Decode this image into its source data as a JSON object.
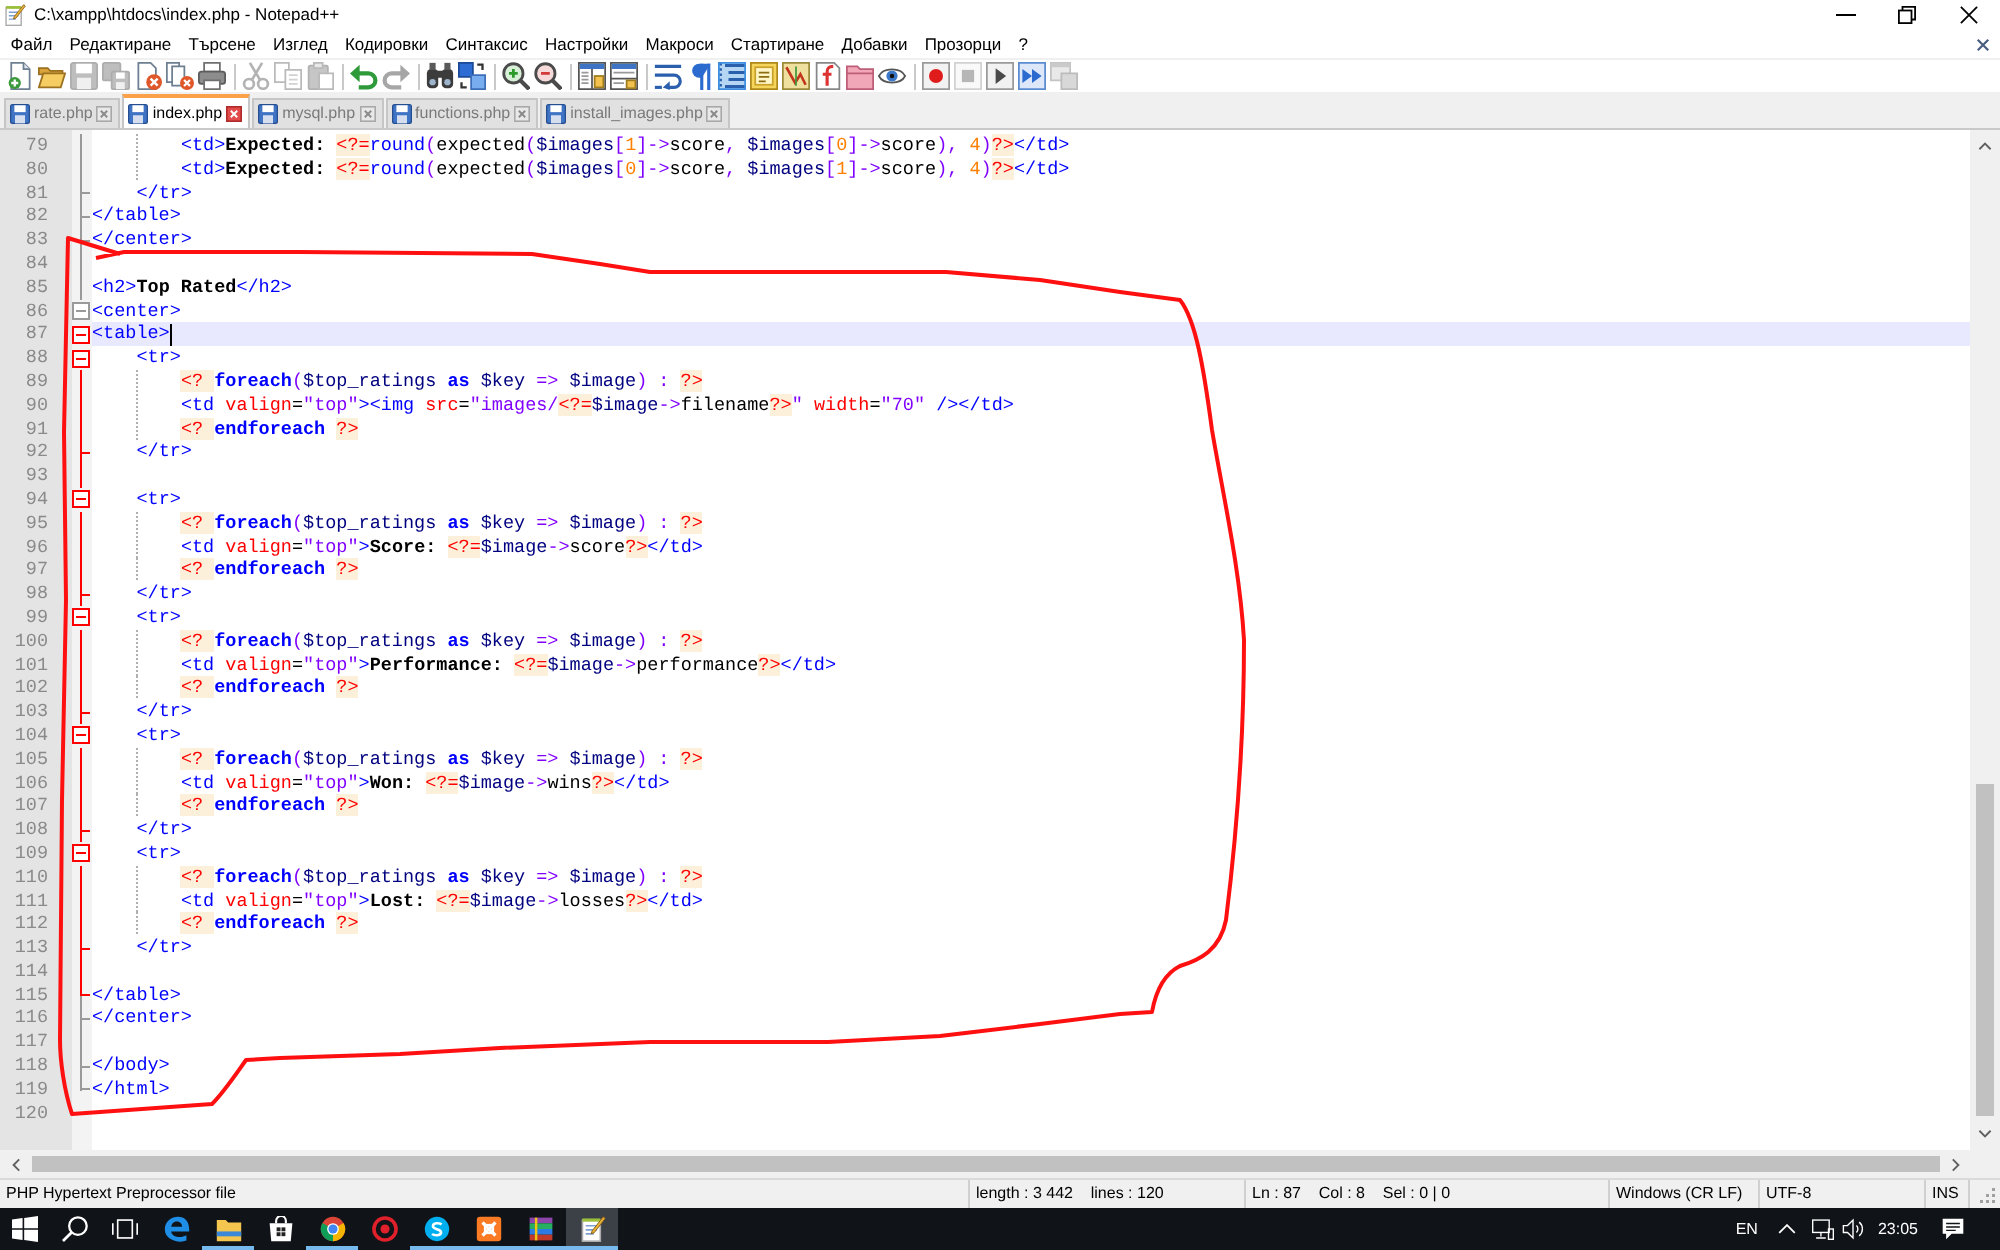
{
  "window": {
    "title": "C:\\xampp\\htdocs\\index.php - Notepad++"
  },
  "menu": [
    "Файл",
    "Редактиране",
    "Търсене",
    "Изглед",
    "Кодировки",
    "Синтаксис",
    "Настройки",
    "Макроси",
    "Стартиране",
    "Добавки",
    "Прозорци",
    "?"
  ],
  "toolbar": {
    "groups": [
      {
        "buttons": [
          {
            "kind": "new",
            "disabled": false,
            "on": false
          },
          {
            "kind": "open",
            "disabled": false,
            "on": false
          },
          {
            "kind": "save",
            "disabled": true,
            "on": false
          },
          {
            "kind": "save-all",
            "disabled": true,
            "on": false
          },
          {
            "kind": "close",
            "disabled": false,
            "on": false
          },
          {
            "kind": "close-all",
            "disabled": false,
            "on": false
          },
          {
            "kind": "print",
            "disabled": false,
            "on": false
          }
        ]
      },
      {
        "buttons": [
          {
            "kind": "cut",
            "disabled": true,
            "on": false
          },
          {
            "kind": "copy",
            "disabled": true,
            "on": false
          },
          {
            "kind": "paste",
            "disabled": true,
            "on": false
          }
        ]
      },
      {
        "buttons": [
          {
            "kind": "undo",
            "disabled": false,
            "on": false
          },
          {
            "kind": "redo",
            "disabled": true,
            "on": false
          }
        ]
      },
      {
        "buttons": [
          {
            "kind": "find",
            "disabled": false,
            "on": false
          },
          {
            "kind": "replace",
            "disabled": false,
            "on": false
          }
        ]
      },
      {
        "buttons": [
          {
            "kind": "zoom-in",
            "disabled": false,
            "on": false
          },
          {
            "kind": "zoom-out",
            "disabled": false,
            "on": false
          }
        ]
      },
      {
        "buttons": [
          {
            "kind": "sync-vertical",
            "disabled": false,
            "on": false
          },
          {
            "kind": "sync-horizontal",
            "disabled": false,
            "on": false
          }
        ]
      },
      {
        "buttons": [
          {
            "kind": "word-wrap",
            "disabled": false,
            "on": false
          },
          {
            "kind": "show-all",
            "disabled": false,
            "on": false
          },
          {
            "kind": "indent-guide",
            "disabled": false,
            "on": true
          },
          {
            "kind": "user-language",
            "disabled": false,
            "on": false
          },
          {
            "kind": "document-map",
            "disabled": false,
            "on": false
          },
          {
            "kind": "function-list",
            "disabled": false,
            "on": false
          },
          {
            "kind": "folder-workspace",
            "disabled": false,
            "on": false
          },
          {
            "kind": "monitoring",
            "disabled": false,
            "on": false
          }
        ]
      },
      {
        "buttons": [
          {
            "kind": "record",
            "disabled": false,
            "on": false
          },
          {
            "kind": "stop",
            "disabled": true,
            "on": false
          },
          {
            "kind": "play",
            "disabled": false,
            "on": false
          },
          {
            "kind": "play-multiple",
            "disabled": false,
            "on": false
          },
          {
            "kind": "save-macro",
            "disabled": true,
            "on": false
          }
        ]
      }
    ]
  },
  "tabs": [
    {
      "label": "rate.php",
      "selected": false
    },
    {
      "label": "index.php",
      "selected": true
    },
    {
      "label": "mysql.php",
      "selected": false
    },
    {
      "label": "functions.php",
      "selected": false
    },
    {
      "label": "install_images.php",
      "selected": false
    }
  ],
  "editor": {
    "lines": [
      {
        "number": "79",
        "tokens": [
          {
            "kind": "tag",
            "text": "        <td>"
          },
          {
            "kind": "text",
            "text": "Expected: "
          },
          {
            "kind": "php-delim",
            "text": "<?="
          },
          {
            "kind": "php-func",
            "text": "round"
          },
          {
            "kind": "php-op",
            "text": "("
          },
          {
            "kind": "plain",
            "text": "expected"
          },
          {
            "kind": "php-op",
            "text": "("
          },
          {
            "kind": "php-var",
            "text": "$images"
          },
          {
            "kind": "php-op",
            "text": "["
          },
          {
            "kind": "php-num",
            "text": "1"
          },
          {
            "kind": "php-op",
            "text": "]->"
          },
          {
            "kind": "plain",
            "text": "score"
          },
          {
            "kind": "php-op",
            "text": ", "
          },
          {
            "kind": "php-var",
            "text": "$images"
          },
          {
            "kind": "php-op",
            "text": "["
          },
          {
            "kind": "php-num",
            "text": "0"
          },
          {
            "kind": "php-op",
            "text": "]->"
          },
          {
            "kind": "plain",
            "text": "score"
          },
          {
            "kind": "php-op",
            "text": "), "
          },
          {
            "kind": "php-num",
            "text": "4"
          },
          {
            "kind": "php-op",
            "text": ")"
          },
          {
            "kind": "php-delim",
            "text": "?>"
          },
          {
            "kind": "tag",
            "text": "</td>"
          }
        ],
        "fold": {
          "kind": "line",
          "highlight": false
        },
        "current": false
      },
      {
        "number": "80",
        "tokens": [
          {
            "kind": "tag",
            "text": "        <td>"
          },
          {
            "kind": "text",
            "text": "Expected: "
          },
          {
            "kind": "php-delim",
            "text": "<?="
          },
          {
            "kind": "php-func",
            "text": "round"
          },
          {
            "kind": "php-op",
            "text": "("
          },
          {
            "kind": "plain",
            "text": "expected"
          },
          {
            "kind": "php-op",
            "text": "("
          },
          {
            "kind": "php-var",
            "text": "$images"
          },
          {
            "kind": "php-op",
            "text": "["
          },
          {
            "kind": "php-num",
            "text": "0"
          },
          {
            "kind": "php-op",
            "text": "]->"
          },
          {
            "kind": "plain",
            "text": "score"
          },
          {
            "kind": "php-op",
            "text": ", "
          },
          {
            "kind": "php-var",
            "text": "$images"
          },
          {
            "kind": "php-op",
            "text": "["
          },
          {
            "kind": "php-num",
            "text": "1"
          },
          {
            "kind": "php-op",
            "text": "]->"
          },
          {
            "kind": "plain",
            "text": "score"
          },
          {
            "kind": "php-op",
            "text": "), "
          },
          {
            "kind": "php-num",
            "text": "4"
          },
          {
            "kind": "php-op",
            "text": ")"
          },
          {
            "kind": "php-delim",
            "text": "?>"
          },
          {
            "kind": "tag",
            "text": "</td>"
          }
        ],
        "fold": {
          "kind": "line",
          "highlight": false
        },
        "current": false
      },
      {
        "number": "81",
        "tokens": [
          {
            "kind": "tag",
            "text": "    </tr>"
          }
        ],
        "fold": {
          "kind": "tick",
          "highlight": false
        },
        "current": false
      },
      {
        "number": "82",
        "tokens": [
          {
            "kind": "tag",
            "text": "</table>"
          }
        ],
        "fold": {
          "kind": "tick",
          "highlight": false
        },
        "current": false
      },
      {
        "number": "83",
        "tokens": [
          {
            "kind": "tag",
            "text": "</center>"
          }
        ],
        "fold": {
          "kind": "tick",
          "highlight": false
        },
        "current": false
      },
      {
        "number": "84",
        "fold": {
          "kind": "line",
          "highlight": false
        },
        "current": false
      },
      {
        "number": "85",
        "tokens": [
          {
            "kind": "tag",
            "text": "<h2>"
          },
          {
            "kind": "text",
            "text": "Top Rated"
          },
          {
            "kind": "tag",
            "text": "</h2>"
          }
        ],
        "fold": {
          "kind": "line",
          "highlight": false
        },
        "current": false
      },
      {
        "number": "86",
        "tokens": [
          {
            "kind": "tag",
            "text": "<center>"
          }
        ],
        "fold": {
          "kind": "box",
          "highlight": false
        },
        "current": false
      },
      {
        "number": "87",
        "tokens": [
          {
            "kind": "tag",
            "text": "<table>"
          }
        ],
        "fold": {
          "kind": "box",
          "highlight": true
        },
        "current": true
      },
      {
        "number": "88",
        "tokens": [
          {
            "kind": "tag",
            "text": "    <tr>"
          }
        ],
        "fold": {
          "kind": "box",
          "highlight": true
        },
        "current": false
      },
      {
        "number": "89",
        "tokens": [
          {
            "kind": "php-delim",
            "text": "        <? "
          },
          {
            "kind": "php-keyword",
            "text": "foreach"
          },
          {
            "kind": "php-op",
            "text": "("
          },
          {
            "kind": "php-var",
            "text": "$top_ratings "
          },
          {
            "kind": "php-keyword",
            "text": "as "
          },
          {
            "kind": "php-var",
            "text": "$key "
          },
          {
            "kind": "php-op",
            "text": "=> "
          },
          {
            "kind": "php-var",
            "text": "$image"
          },
          {
            "kind": "php-op",
            "text": ") : "
          },
          {
            "kind": "php-delim",
            "text": "?>"
          }
        ],
        "fold": {
          "kind": "line",
          "highlight": true
        },
        "current": false
      },
      {
        "number": "90",
        "tokens": [
          {
            "kind": "tag",
            "text": "        <td "
          },
          {
            "kind": "attr",
            "text": "valign"
          },
          {
            "kind": "plain",
            "text": "="
          },
          {
            "kind": "value",
            "text": "\"top\""
          },
          {
            "kind": "tag",
            "text": "><img "
          },
          {
            "kind": "attr",
            "text": "src"
          },
          {
            "kind": "plain",
            "text": "="
          },
          {
            "kind": "value",
            "text": "\"images/"
          },
          {
            "kind": "php-delim",
            "text": "<?="
          },
          {
            "kind": "php-var",
            "text": "$image"
          },
          {
            "kind": "php-op",
            "text": "->"
          },
          {
            "kind": "plain",
            "text": "filename"
          },
          {
            "kind": "php-delim",
            "text": "?>"
          },
          {
            "kind": "value",
            "text": "\" "
          },
          {
            "kind": "attr",
            "text": "width"
          },
          {
            "kind": "plain",
            "text": "="
          },
          {
            "kind": "value",
            "text": "\"70\""
          },
          {
            "kind": "tag",
            "text": " /></td>"
          }
        ],
        "fold": {
          "kind": "line",
          "highlight": true
        },
        "current": false
      },
      {
        "number": "91",
        "tokens": [
          {
            "kind": "php-delim",
            "text": "        <? "
          },
          {
            "kind": "php-keyword",
            "text": "endforeach "
          },
          {
            "kind": "php-delim",
            "text": "?>"
          }
        ],
        "fold": {
          "kind": "line",
          "highlight": true
        },
        "current": false
      },
      {
        "number": "92",
        "tokens": [
          {
            "kind": "tag",
            "text": "    </tr>"
          }
        ],
        "fold": {
          "kind": "tick",
          "highlight": true
        },
        "current": false
      },
      {
        "number": "93",
        "fold": {
          "kind": "line",
          "highlight": true
        },
        "current": false
      },
      {
        "number": "94",
        "tokens": [
          {
            "kind": "tag",
            "text": "    <tr>"
          }
        ],
        "fold": {
          "kind": "box",
          "highlight": true
        },
        "current": false
      },
      {
        "number": "95",
        "tokens": [
          {
            "kind": "php-delim",
            "text": "        <? "
          },
          {
            "kind": "php-keyword",
            "text": "foreach"
          },
          {
            "kind": "php-op",
            "text": "("
          },
          {
            "kind": "php-var",
            "text": "$top_ratings "
          },
          {
            "kind": "php-keyword",
            "text": "as "
          },
          {
            "kind": "php-var",
            "text": "$key "
          },
          {
            "kind": "php-op",
            "text": "=> "
          },
          {
            "kind": "php-var",
            "text": "$image"
          },
          {
            "kind": "php-op",
            "text": ") : "
          },
          {
            "kind": "php-delim",
            "text": "?>"
          }
        ],
        "fold": {
          "kind": "line",
          "highlight": true
        },
        "current": false
      },
      {
        "number": "96",
        "tokens": [
          {
            "kind": "tag",
            "text": "        <td "
          },
          {
            "kind": "attr",
            "text": "valign"
          },
          {
            "kind": "plain",
            "text": "="
          },
          {
            "kind": "value",
            "text": "\"top\""
          },
          {
            "kind": "tag",
            "text": ">"
          },
          {
            "kind": "text",
            "text": "Score: "
          },
          {
            "kind": "php-delim",
            "text": "<?="
          },
          {
            "kind": "php-var",
            "text": "$image"
          },
          {
            "kind": "php-op",
            "text": "->"
          },
          {
            "kind": "plain",
            "text": "score"
          },
          {
            "kind": "php-delim",
            "text": "?>"
          },
          {
            "kind": "tag",
            "text": "</td>"
          }
        ],
        "fold": {
          "kind": "line",
          "highlight": true
        },
        "current": false
      },
      {
        "number": "97",
        "tokens": [
          {
            "kind": "php-delim",
            "text": "        <? "
          },
          {
            "kind": "php-keyword",
            "text": "endforeach "
          },
          {
            "kind": "php-delim",
            "text": "?>"
          }
        ],
        "fold": {
          "kind": "line",
          "highlight": true
        },
        "current": false
      },
      {
        "number": "98",
        "tokens": [
          {
            "kind": "tag",
            "text": "    </tr>"
          }
        ],
        "fold": {
          "kind": "tick",
          "highlight": true
        },
        "current": false
      },
      {
        "number": "99",
        "tokens": [
          {
            "kind": "tag",
            "text": "    <tr>"
          }
        ],
        "fold": {
          "kind": "box",
          "highlight": true
        },
        "current": false
      },
      {
        "number": "100",
        "tokens": [
          {
            "kind": "php-delim",
            "text": "        <? "
          },
          {
            "kind": "php-keyword",
            "text": "foreach"
          },
          {
            "kind": "php-op",
            "text": "("
          },
          {
            "kind": "php-var",
            "text": "$top_ratings "
          },
          {
            "kind": "php-keyword",
            "text": "as "
          },
          {
            "kind": "php-var",
            "text": "$key "
          },
          {
            "kind": "php-op",
            "text": "=> "
          },
          {
            "kind": "php-var",
            "text": "$image"
          },
          {
            "kind": "php-op",
            "text": ") : "
          },
          {
            "kind": "php-delim",
            "text": "?>"
          }
        ],
        "fold": {
          "kind": "line",
          "highlight": true
        },
        "current": false
      },
      {
        "number": "101",
        "tokens": [
          {
            "kind": "tag",
            "text": "        <td "
          },
          {
            "kind": "attr",
            "text": "valign"
          },
          {
            "kind": "plain",
            "text": "="
          },
          {
            "kind": "value",
            "text": "\"top\""
          },
          {
            "kind": "tag",
            "text": ">"
          },
          {
            "kind": "text",
            "text": "Performance: "
          },
          {
            "kind": "php-delim",
            "text": "<?="
          },
          {
            "kind": "php-var",
            "text": "$image"
          },
          {
            "kind": "php-op",
            "text": "->"
          },
          {
            "kind": "plain",
            "text": "performance"
          },
          {
            "kind": "php-delim",
            "text": "?>"
          },
          {
            "kind": "tag",
            "text": "</td>"
          }
        ],
        "fold": {
          "kind": "line",
          "highlight": true
        },
        "current": false
      },
      {
        "number": "102",
        "tokens": [
          {
            "kind": "php-delim",
            "text": "        <? "
          },
          {
            "kind": "php-keyword",
            "text": "endforeach "
          },
          {
            "kind": "php-delim",
            "text": "?>"
          }
        ],
        "fold": {
          "kind": "line",
          "highlight": true
        },
        "current": false
      },
      {
        "number": "103",
        "tokens": [
          {
            "kind": "tag",
            "text": "    </tr>"
          }
        ],
        "fold": {
          "kind": "tick",
          "highlight": true
        },
        "current": false
      },
      {
        "number": "104",
        "tokens": [
          {
            "kind": "tag",
            "text": "    <tr>"
          }
        ],
        "fold": {
          "kind": "box",
          "highlight": true
        },
        "current": false
      },
      {
        "number": "105",
        "tokens": [
          {
            "kind": "php-delim",
            "text": "        <? "
          },
          {
            "kind": "php-keyword",
            "text": "foreach"
          },
          {
            "kind": "php-op",
            "text": "("
          },
          {
            "kind": "php-var",
            "text": "$top_ratings "
          },
          {
            "kind": "php-keyword",
            "text": "as "
          },
          {
            "kind": "php-var",
            "text": "$key "
          },
          {
            "kind": "php-op",
            "text": "=> "
          },
          {
            "kind": "php-var",
            "text": "$image"
          },
          {
            "kind": "php-op",
            "text": ") : "
          },
          {
            "kind": "php-delim",
            "text": "?>"
          }
        ],
        "fold": {
          "kind": "line",
          "highlight": true
        },
        "current": false
      },
      {
        "number": "106",
        "tokens": [
          {
            "kind": "tag",
            "text": "        <td "
          },
          {
            "kind": "attr",
            "text": "valign"
          },
          {
            "kind": "plain",
            "text": "="
          },
          {
            "kind": "value",
            "text": "\"top\""
          },
          {
            "kind": "tag",
            "text": ">"
          },
          {
            "kind": "text",
            "text": "Won: "
          },
          {
            "kind": "php-delim",
            "text": "<?="
          },
          {
            "kind": "php-var",
            "text": "$image"
          },
          {
            "kind": "php-op",
            "text": "->"
          },
          {
            "kind": "plain",
            "text": "wins"
          },
          {
            "kind": "php-delim",
            "text": "?>"
          },
          {
            "kind": "tag",
            "text": "</td>"
          }
        ],
        "fold": {
          "kind": "line",
          "highlight": true
        },
        "current": false
      },
      {
        "number": "107",
        "tokens": [
          {
            "kind": "php-delim",
            "text": "        <? "
          },
          {
            "kind": "php-keyword",
            "text": "endforeach "
          },
          {
            "kind": "php-delim",
            "text": "?>"
          }
        ],
        "fold": {
          "kind": "line",
          "highlight": true
        },
        "current": false
      },
      {
        "number": "108",
        "tokens": [
          {
            "kind": "tag",
            "text": "    </tr>"
          }
        ],
        "fold": {
          "kind": "tick",
          "highlight": true
        },
        "current": false
      },
      {
        "number": "109",
        "tokens": [
          {
            "kind": "tag",
            "text": "    <tr>"
          }
        ],
        "fold": {
          "kind": "box",
          "highlight": true
        },
        "current": false
      },
      {
        "number": "110",
        "tokens": [
          {
            "kind": "php-delim",
            "text": "        <? "
          },
          {
            "kind": "php-keyword",
            "text": "foreach"
          },
          {
            "kind": "php-op",
            "text": "("
          },
          {
            "kind": "php-var",
            "text": "$top_ratings "
          },
          {
            "kind": "php-keyword",
            "text": "as "
          },
          {
            "kind": "php-var",
            "text": "$key "
          },
          {
            "kind": "php-op",
            "text": "=> "
          },
          {
            "kind": "php-var",
            "text": "$image"
          },
          {
            "kind": "php-op",
            "text": ") : "
          },
          {
            "kind": "php-delim",
            "text": "?>"
          }
        ],
        "fold": {
          "kind": "line",
          "highlight": true
        },
        "current": false
      },
      {
        "number": "111",
        "tokens": [
          {
            "kind": "tag",
            "text": "        <td "
          },
          {
            "kind": "attr",
            "text": "valign"
          },
          {
            "kind": "plain",
            "text": "="
          },
          {
            "kind": "value",
            "text": "\"top\""
          },
          {
            "kind": "tag",
            "text": ">"
          },
          {
            "kind": "text",
            "text": "Lost: "
          },
          {
            "kind": "php-delim",
            "text": "<?="
          },
          {
            "kind": "php-var",
            "text": "$image"
          },
          {
            "kind": "php-op",
            "text": "->"
          },
          {
            "kind": "plain",
            "text": "losses"
          },
          {
            "kind": "php-delim",
            "text": "?>"
          },
          {
            "kind": "tag",
            "text": "</td>"
          }
        ],
        "fold": {
          "kind": "line",
          "highlight": true
        },
        "current": false
      },
      {
        "number": "112",
        "tokens": [
          {
            "kind": "php-delim",
            "text": "        <? "
          },
          {
            "kind": "php-keyword",
            "text": "endforeach "
          },
          {
            "kind": "php-delim",
            "text": "?>"
          }
        ],
        "fold": {
          "kind": "line",
          "highlight": true
        },
        "current": false
      },
      {
        "number": "113",
        "tokens": [
          {
            "kind": "tag",
            "text": "    </tr>"
          }
        ],
        "fold": {
          "kind": "tick",
          "highlight": true
        },
        "current": false
      },
      {
        "number": "114",
        "fold": {
          "kind": "line",
          "highlight": true
        },
        "current": false
      },
      {
        "number": "115",
        "tokens": [
          {
            "kind": "tag",
            "text": "</table>"
          }
        ],
        "fold": {
          "kind": "tick",
          "highlight": true
        },
        "current": false
      },
      {
        "number": "116",
        "tokens": [
          {
            "kind": "tag",
            "text": "</center>"
          }
        ],
        "fold": {
          "kind": "tick",
          "highlight": false
        },
        "current": false
      },
      {
        "number": "117",
        "fold": {
          "kind": "line",
          "highlight": false
        },
        "current": false
      },
      {
        "number": "118",
        "tokens": [
          {
            "kind": "tag",
            "text": "</body>"
          }
        ],
        "fold": {
          "kind": "tick",
          "highlight": false
        },
        "current": false
      },
      {
        "number": "119",
        "tokens": [
          {
            "kind": "tag",
            "text": "</html>"
          }
        ],
        "fold": {
          "kind": "end",
          "highlight": false
        },
        "current": false
      },
      {
        "number": "120",
        "current": false
      }
    ]
  },
  "annotation": {
    "kind": "freehand-outline"
  },
  "status_bar": [
    "PHP Hypertext Preprocessor file",
    "length : 3 442    lines : 120",
    "Ln : 87    Col : 8    Sel : 0 | 0",
    "Windows (CR LF)",
    "UTF-8",
    "INS"
  ],
  "taskbar": {
    "system_buttons": [
      {
        "kind": "start"
      },
      {
        "kind": "search"
      },
      {
        "kind": "task-view"
      }
    ],
    "apps": [
      {
        "kind": "e-logo",
        "running": false,
        "selected": false
      },
      {
        "kind": "folder",
        "running": true,
        "selected": false
      },
      {
        "kind": "bag",
        "running": false,
        "selected": false
      },
      {
        "kind": "ring-logo",
        "running": true,
        "selected": false
      },
      {
        "kind": "target",
        "running": false,
        "selected": false
      },
      {
        "kind": "s-logo",
        "running": true,
        "selected": false
      },
      {
        "kind": "square-logo",
        "running": true,
        "selected": false
      },
      {
        "kind": "book-stack",
        "running": true,
        "selected": false
      },
      {
        "kind": "notepad",
        "running": true,
        "selected": true
      }
    ],
    "language": "EN",
    "clock": "23:05"
  }
}
